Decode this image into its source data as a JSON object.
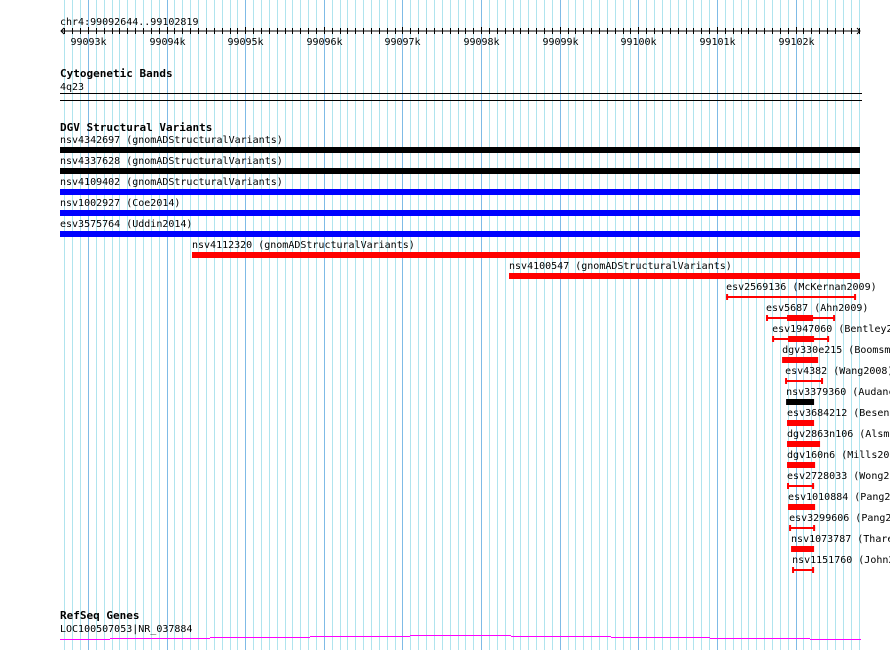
{
  "ruler": {
    "position": "chr4:99092644..99102819",
    "start": 99092644,
    "end": 99102819,
    "tick_labels": [
      "99093k",
      "99094k",
      "99095k",
      "99096k",
      "99097k",
      "99098k",
      "99099k",
      "99100k",
      "99101k",
      "99102k"
    ]
  },
  "cytoband": {
    "title": "Cytogenetic Bands",
    "band": "4q23"
  },
  "dgv": {
    "title": "DGV Structural Variants",
    "items": [
      {
        "label": "nsv4342697 (gnomADStructuralVariants)",
        "color": "#000000",
        "type": "thick",
        "start": 99092644,
        "end": 99102819
      },
      {
        "label": "nsv4337628 (gnomADStructuralVariants)",
        "color": "#000000",
        "type": "thick",
        "start": 99092644,
        "end": 99102819
      },
      {
        "label": "nsv4109402 (gnomADStructuralVariants)",
        "color": "#0000ff",
        "type": "thick",
        "start": 99092644,
        "end": 99102819
      },
      {
        "label": "nsv1002927 (Coe2014)",
        "color": "#0000ff",
        "type": "thick",
        "start": 99092644,
        "end": 99102819
      },
      {
        "label": "esv3575764 (Uddin2014)",
        "color": "#0000ff",
        "type": "thick",
        "start": 99092644,
        "end": 99102819
      },
      {
        "label": "nsv4112320 (gnomADStructuralVariants)",
        "color": "#ff0000",
        "type": "thick",
        "start": 99094323,
        "end": 99102819
      },
      {
        "label": "nsv4100547 (gnomADStructuralVariants)",
        "color": "#ff0000",
        "type": "thick",
        "start": 99098355,
        "end": 99102819
      },
      {
        "label": "esv2569136 (McKernan2009)",
        "color": "#ff0000",
        "type": "line",
        "start": 99101116,
        "end": 99102769
      },
      {
        "label": "esv5687 (Ahn2009)",
        "color": "#ff0000",
        "type": "line",
        "start": 99101624,
        "end": 99102502,
        "thick_start": 99101891,
        "thick_end": 99102222
      },
      {
        "label": "esv1947060 (Bentley2",
        "color": "#ff0000",
        "type": "line",
        "start": 99101701,
        "end": 99102426,
        "thick_start": 99101904,
        "thick_end": 99102235
      },
      {
        "label": "dgv330e215 (Boomsm",
        "color": "#ff0000",
        "type": "thick",
        "start": 99101828,
        "end": 99102286
      },
      {
        "label": "esv4382 (Wang2008)",
        "color": "#ff0000",
        "type": "line",
        "start": 99101866,
        "end": 99102349
      },
      {
        "label": "nsv3379360 (Audanc",
        "color": "#000000",
        "type": "thick",
        "start": 99101879,
        "end": 99102235
      },
      {
        "label": "esv3684212 (Besenb",
        "color": "#ff0000",
        "type": "thick",
        "start": 99101891,
        "end": 99102235
      },
      {
        "label": "dgv2863n106 (Alsma",
        "color": "#ff0000",
        "type": "thick",
        "start": 99101891,
        "end": 99102311
      },
      {
        "label": "dgv160n6 (Mills200",
        "color": "#ff0000",
        "type": "thick",
        "start": 99101891,
        "end": 99102248
      },
      {
        "label": "esv2728033 (Wong20",
        "color": "#ff0000",
        "type": "line",
        "start": 99101891,
        "end": 99102235
      },
      {
        "label": "esv1010884 (Pang2",
        "color": "#ff0000",
        "type": "thick",
        "start": 99101904,
        "end": 99102248
      },
      {
        "label": "esv3299606 (Pang2",
        "color": "#ff0000",
        "type": "line",
        "start": 99101917,
        "end": 99102248
      },
      {
        "label": "nsv1073787 (Thare",
        "color": "#ff0000",
        "type": "thick",
        "start": 99101942,
        "end": 99102235
      },
      {
        "label": "nsv1151760 (John2",
        "color": "#ff0000",
        "type": "line",
        "start": 99101955,
        "end": 99102235
      }
    ]
  },
  "refseq": {
    "title": "RefSeq Genes",
    "gene": "LOC100507053|NR_037884",
    "color": "#ff00ff"
  },
  "colors": {
    "grid": "#b0e4ee",
    "grid_major": "#7fbbe6"
  }
}
